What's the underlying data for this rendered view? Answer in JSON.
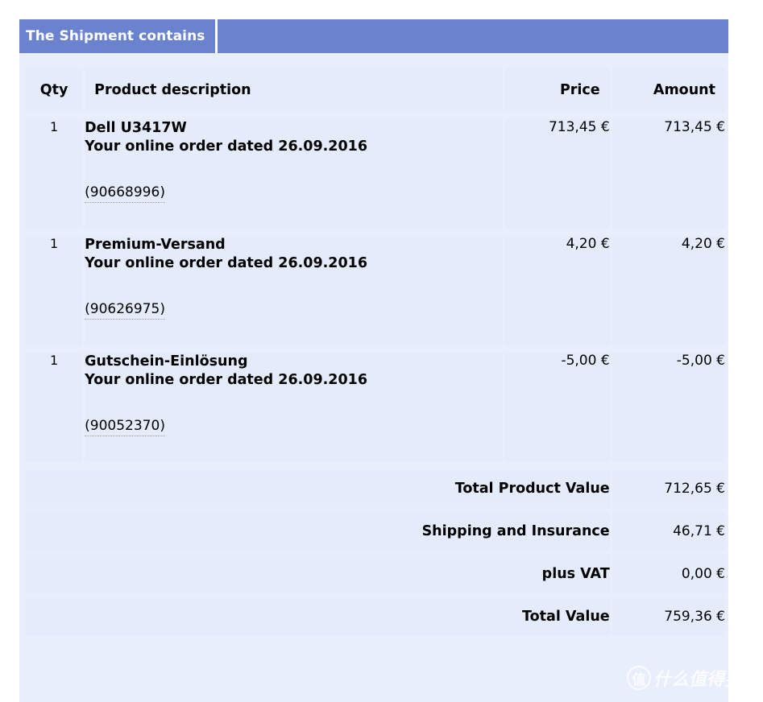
{
  "tabs": {
    "active_label": "The Shipment contains"
  },
  "table": {
    "columns": {
      "qty": "Qty",
      "description": "Product description",
      "price": "Price",
      "amount": "Amount"
    },
    "rows": [
      {
        "qty": "1",
        "name": "Dell U3417W",
        "order_line": "Your online order dated 26.09.2016",
        "reference": "(90668996)",
        "price": "713,45 €",
        "amount": "713,45 €"
      },
      {
        "qty": "1",
        "name": "Premium-Versand",
        "order_line": "Your online order dated 26.09.2016",
        "reference": "(90626975)",
        "price": "4,20 €",
        "amount": "4,20 €"
      },
      {
        "qty": "1",
        "name": "Gutschein-Einlösung",
        "order_line": "Your online order dated 26.09.2016",
        "reference": "(90052370)",
        "price": "-5,00 €",
        "amount": "-5,00 €"
      }
    ],
    "summary": [
      {
        "label": "Total Product Value",
        "value": "712,65 €"
      },
      {
        "label": "Shipping and Insurance",
        "value": "46,71 €"
      },
      {
        "label": "plus VAT",
        "value": "0,00 €"
      },
      {
        "label": "Total Value",
        "value": "759,36 €"
      }
    ]
  },
  "watermark": {
    "badge": "值",
    "text": "什么值得买"
  },
  "colors": {
    "tab_blue": "#6b83cf",
    "cell_blue": "#e4ecfb",
    "panel_blue": "#e8eefc"
  }
}
